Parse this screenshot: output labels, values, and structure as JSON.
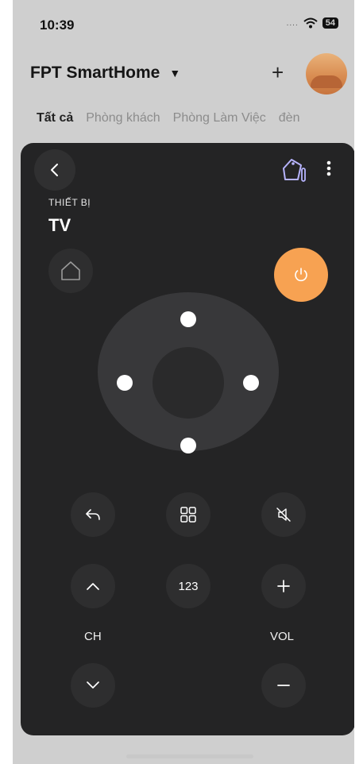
{
  "status_bar": {
    "time": "10:39",
    "signal": "....",
    "battery": "54"
  },
  "header": {
    "title": "FPT SmartHome",
    "caret": "▼",
    "add": "+"
  },
  "tabs": [
    {
      "label": "Tất cả",
      "active": true
    },
    {
      "label": "Phòng khách",
      "active": false
    },
    {
      "label": "Phòng Làm Việc",
      "active": false
    },
    {
      "label": "đèn",
      "active": false
    }
  ],
  "device": {
    "label": "THIẾT BỊ",
    "name": "TV"
  },
  "remote": {
    "numpad_label": "123",
    "ch_label": "CH",
    "vol_label": "VOL",
    "power_color": "#f7a252"
  },
  "icons": [
    "chevron-left-icon",
    "tag-pen-icon",
    "more-vertical-icon",
    "home-icon",
    "power-icon",
    "return-icon",
    "grid-icon",
    "mute-icon",
    "chevron-up-icon",
    "plus-icon",
    "chevron-down-icon",
    "minus-icon"
  ]
}
